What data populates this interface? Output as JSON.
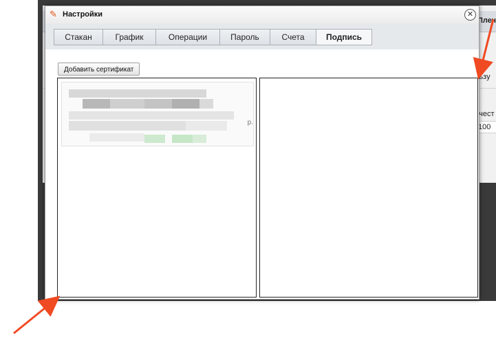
{
  "background_app": {
    "title_fragment": "Плеч",
    "user_fragment": "льзу",
    "qty_fragment": "ичест",
    "qty_value": "100"
  },
  "dialog": {
    "title": "Настройки",
    "close_icon": "close-circle-icon",
    "title_icon": "wrench-icon",
    "tabs": [
      {
        "label": "Стакан",
        "active": false
      },
      {
        "label": "График",
        "active": false
      },
      {
        "label": "Операции",
        "active": false
      },
      {
        "label": "Пароль",
        "active": false
      },
      {
        "label": "Счета",
        "active": false
      },
      {
        "label": "Подпись",
        "active": true
      }
    ],
    "add_certificate_label": "Добавить сертификат",
    "certificate_edge_char": "р."
  },
  "colors": {
    "arrow": "#f04a23",
    "backdrop": "#3a3a3a",
    "accent_icon": "#e0581a"
  }
}
